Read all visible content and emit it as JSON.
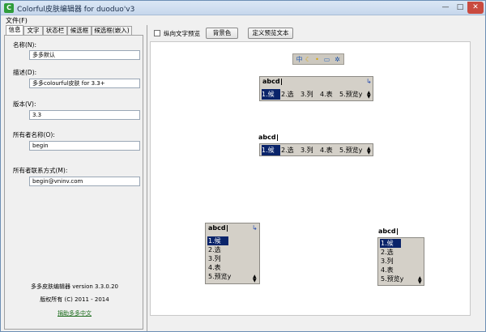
{
  "window": {
    "title": "Colorful皮肤编辑器 for duoduo'v3",
    "app_icon": "C"
  },
  "menu": {
    "file_label": "文件(F)"
  },
  "tabs": [
    "信息",
    "文字",
    "状态栏",
    "候选框",
    "候选框(嵌入)"
  ],
  "info": {
    "name_label": "名称(N):",
    "name_value": "多多默认",
    "desc_label": "描述(D):",
    "desc_value": "多多colourful皮肤 for 3.3+",
    "version_label": "版本(V):",
    "version_value": "3.3",
    "owner_label": "所有者名称(O):",
    "owner_value": "begin",
    "contact_label": "所有者联系方式(M):",
    "contact_value": "begin@vninv.com"
  },
  "footer": {
    "version": "多多皮肤编辑器 version 3.3.0.20",
    "copyright": "版权所有 (C) 2011 - 2014",
    "donate": "捐助多多中文"
  },
  "toolbar": {
    "vertical_preview_label": "纵向文字预览",
    "background_button": "背景色",
    "custom_text_button": "定义预览文本"
  },
  "preview": {
    "composition": "abcd",
    "candidates": [
      "1.候",
      "2.选",
      "3.列",
      "4.表",
      "5.预览y"
    ],
    "updown_icon": "▲▼"
  },
  "icons": {
    "statusbar": [
      "ime-icon",
      "moon-icon",
      "punct-icon",
      "keyboard-icon",
      "gear-icon"
    ],
    "arrow": "arrow-icon"
  },
  "colors": {
    "selection": "#0a246a",
    "candidate_bg": "#d4d0c8",
    "donate_link": "#1a6b1a"
  }
}
